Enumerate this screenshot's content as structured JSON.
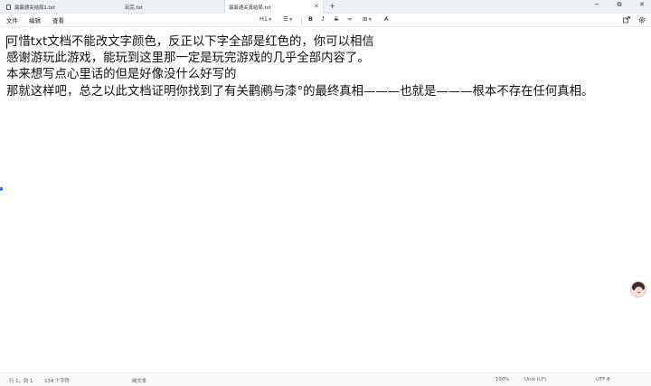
{
  "tabs": [
    {
      "label": "最最通关结局1.txt"
    },
    {
      "label": "玩完.txt"
    },
    {
      "label": "最最通关真结局.txt"
    }
  ],
  "window": {
    "minimize": "─",
    "maximize": "⧉",
    "close": "✕",
    "new_tab": "+"
  },
  "menu": {
    "file": "文件",
    "edit": "编辑",
    "view": "查看"
  },
  "toolbar": {
    "heading": "H1",
    "list": "☰",
    "bold": "B",
    "italic": "I",
    "strike": "S",
    "link": "∞",
    "table": "⊞",
    "clear_format": "A̸"
  },
  "document": {
    "lines": [
      "可惜txt文档不能改文字颜色，反正以下字全部是红色的，你可以相信",
      "感谢游玩此游戏，能玩到这里那一定是玩完游戏的几乎全部内容了。",
      "本来想写点心里话的但是好像没什么好写的",
      "那就这样吧，总之以此文档证明你找到了有关鹳鹇与漆°的最终真相———也就是———根本不存在任何真相。"
    ]
  },
  "status": {
    "position": "行 1，列 1",
    "char_count": "134 个字符",
    "format": "纯文本",
    "zoom": "100%",
    "line_ending": "Unix (LF)",
    "encoding": "UTF-8"
  },
  "colors": {
    "accent": "#1a73e8",
    "titlebar": "#eceff3"
  },
  "icons": {
    "file": "file-icon",
    "share": "share-icon",
    "settings": "gear-icon",
    "avatar": "assistant-avatar-icon"
  }
}
